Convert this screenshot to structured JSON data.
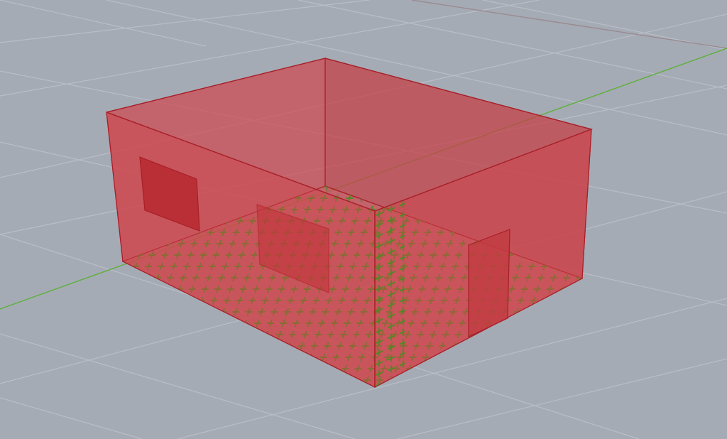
{
  "viewport": {
    "name": "perspective-3d-viewport",
    "projection": "perspective",
    "background_color": "#a5abb5"
  },
  "grid": {
    "visible": true,
    "line_color": "#b9bec6",
    "x_axis_color": "#7a9e62",
    "x_axis_far_color": "#5db03a",
    "y_axis_color": "#9a8a8f"
  },
  "room_box": {
    "fill_color": "#d0454c",
    "edge_color": "#a81f28",
    "opacity": 0.7
  },
  "openings": [
    {
      "name": "window-opening-left-wall",
      "fill_color": "#b5262c"
    },
    {
      "name": "interior-partition-panel",
      "fill_color": "#b5262c"
    },
    {
      "name": "door-opening-right-wall",
      "fill_color": "#c23a40"
    }
  ],
  "sensor_grid": {
    "marker_shape": "cross",
    "marker_color": "#4e8a22",
    "surfaces": [
      "floor",
      "front-wall",
      "right-wall"
    ]
  }
}
